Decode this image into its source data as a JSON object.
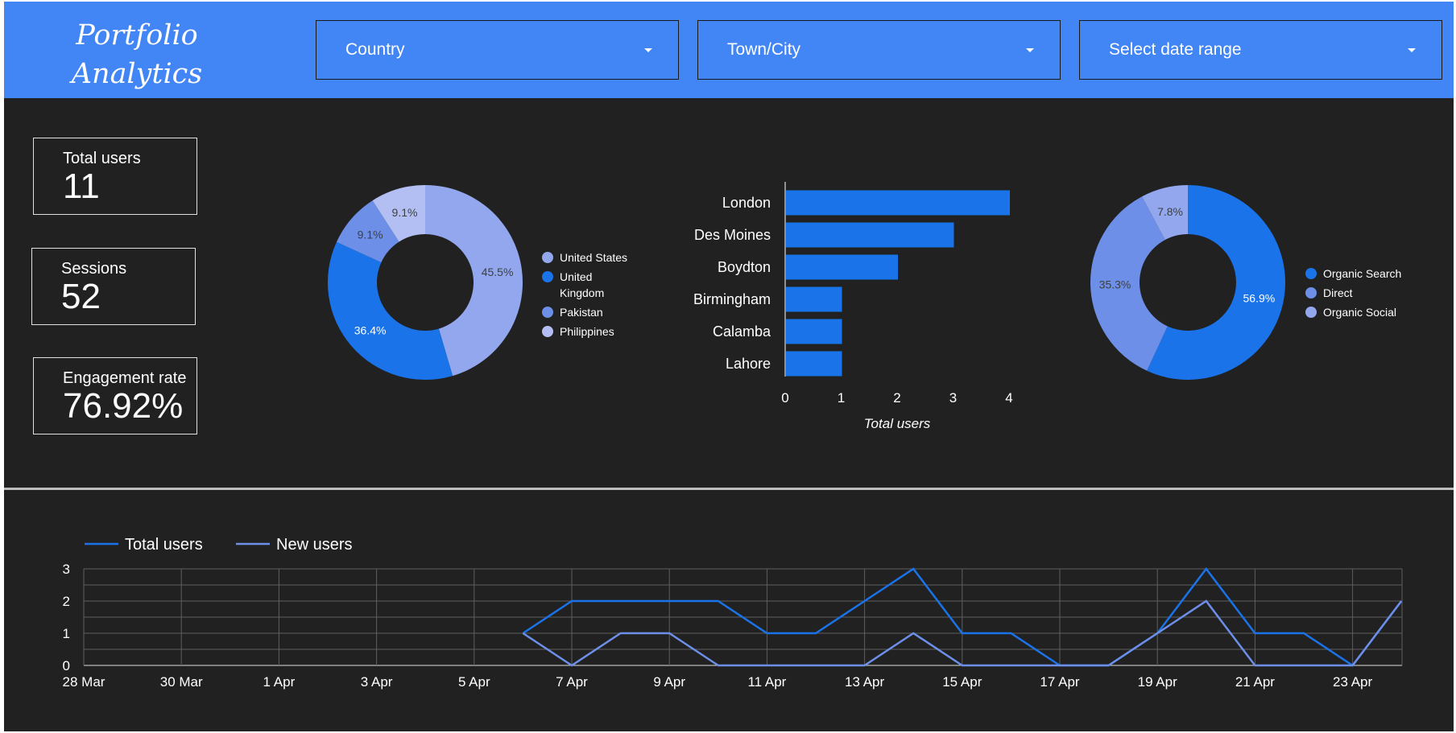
{
  "header": {
    "title_line1": "Portfolio",
    "title_line2": "Analytics",
    "filters": [
      {
        "label": "Country"
      },
      {
        "label": "Town/City"
      },
      {
        "label": "Select date range"
      }
    ]
  },
  "kpis": [
    {
      "label": "Total users",
      "value": "11"
    },
    {
      "label": "Sessions",
      "value": "52"
    },
    {
      "label": "Engagement rate",
      "value": "76.92%"
    }
  ],
  "colors": {
    "header": "#4285f4",
    "background": "#212121",
    "series_primary": "#1a73e8",
    "series_secondary": "#6d8fe8",
    "series_tertiary": "#93a7ee",
    "series_light": "#b3bff2"
  },
  "chart_data": [
    {
      "type": "pie",
      "donut": true,
      "labels": [
        "United States",
        "United Kingdom",
        "Pakistan",
        "Philippines"
      ],
      "values": [
        45.5,
        36.4,
        9.1,
        9.1
      ],
      "value_labels": [
        "45.5%",
        "36.4%",
        "9.1%",
        "9.1%"
      ],
      "colors": [
        "#93a7ee",
        "#1a73e8",
        "#6d8fe8",
        "#b3bff2"
      ],
      "legend": "right"
    },
    {
      "type": "bar",
      "orientation": "horizontal",
      "categories": [
        "London",
        "Des Moines",
        "Boydton",
        "Birmingham",
        "Calamba",
        "Lahore"
      ],
      "values": [
        4,
        3,
        2,
        1,
        1,
        1
      ],
      "xlabel": "Total users",
      "xlim": [
        0,
        4
      ],
      "xticks": [
        "0",
        "1",
        "2",
        "3",
        "4"
      ]
    },
    {
      "type": "pie",
      "donut": true,
      "labels": [
        "Organic Search",
        "Direct",
        "Organic Social"
      ],
      "values": [
        56.9,
        35.3,
        7.8
      ],
      "value_labels": [
        "56.9%",
        "35.3%",
        "7.8%"
      ],
      "colors": [
        "#1a73e8",
        "#6d8fe8",
        "#93a7ee"
      ],
      "legend": "right"
    },
    {
      "type": "line",
      "x": [
        "28 Mar",
        "29 Mar",
        "30 Mar",
        "31 Mar",
        "1 Apr",
        "2 Apr",
        "3 Apr",
        "4 Apr",
        "5 Apr",
        "6 Apr",
        "7 Apr",
        "8 Apr",
        "9 Apr",
        "10 Apr",
        "11 Apr",
        "12 Apr",
        "13 Apr",
        "14 Apr",
        "15 Apr",
        "16 Apr",
        "17 Apr",
        "18 Apr",
        "19 Apr",
        "20 Apr",
        "21 Apr",
        "22 Apr",
        "23 Apr",
        "24 Apr"
      ],
      "xticks": [
        "28 Mar",
        "30 Mar",
        "1 Apr",
        "3 Apr",
        "5 Apr",
        "7 Apr",
        "9 Apr",
        "11 Apr",
        "13 Apr",
        "15 Apr",
        "17 Apr",
        "19 Apr",
        "21 Apr",
        "23 Apr"
      ],
      "yticks": [
        "0",
        "1",
        "2",
        "3"
      ],
      "ylim": [
        0,
        3
      ],
      "series": [
        {
          "name": "Total users",
          "color": "#1a73e8",
          "values": [
            null,
            null,
            null,
            null,
            null,
            null,
            null,
            null,
            null,
            1,
            2,
            2,
            2,
            2,
            1,
            1,
            2,
            3,
            1,
            1,
            0,
            0,
            1,
            3,
            1,
            1,
            0,
            2
          ]
        },
        {
          "name": "New users",
          "color": "#6d8fe8",
          "values": [
            null,
            null,
            null,
            null,
            null,
            null,
            null,
            null,
            null,
            1,
            0,
            1,
            1,
            0,
            0,
            0,
            0,
            1,
            0,
            0,
            0,
            0,
            1,
            2,
            0,
            0,
            0,
            2
          ]
        }
      ],
      "legend": "top-left",
      "grid": true
    }
  ]
}
